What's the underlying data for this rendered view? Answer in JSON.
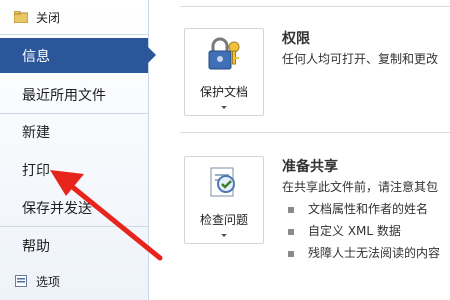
{
  "sidebar": {
    "close": "关闭",
    "items": [
      "信息",
      "最近所用文件",
      "新建",
      "打印",
      "保存并发送",
      "帮助"
    ],
    "options": "选项"
  },
  "permissions": {
    "button_label": "保护文档",
    "title": "权限",
    "description": "任何人均可打开、复制和更改"
  },
  "prepare": {
    "button_label": "检查问题",
    "title": "准备共享",
    "intro": "在共享此文件前，请注意其包",
    "bullets": [
      "文档属性和作者的姓名",
      "自定义 XML 数据",
      "残障人士无法阅读的内容"
    ]
  },
  "colors": {
    "accent": "#2b579a",
    "arrow": "#e8251d"
  }
}
